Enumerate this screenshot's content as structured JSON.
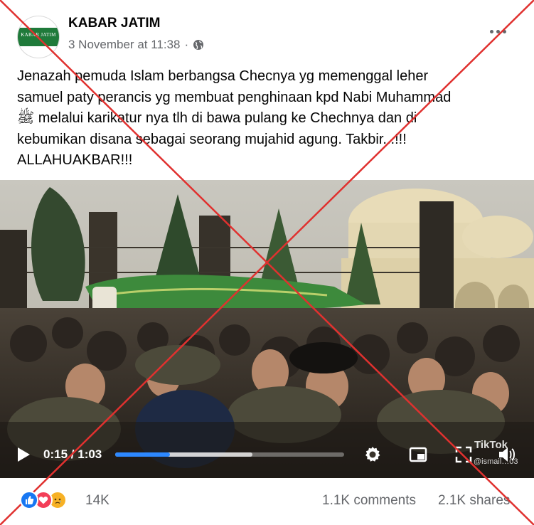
{
  "header": {
    "page_name": "KABAR JATIM",
    "timestamp": "3 November at 11:38",
    "separator": "·",
    "avatar_text": "KABAR JATIM",
    "icons": {
      "audience": "globe-icon",
      "more": "more-options-icon"
    }
  },
  "caption": "Jenazah pemuda Islam berbangsa Checnya yg memenggal leher\nsamuel paty perancis yg membuat penghinaan kpd Nabi Muhammad\nﷺ melalui karikatur nya tlh di bawa pulang ke Chechnya dan di\nkebumikan disana sebagai seorang mujahid agung. Takbir...!!!\nALLAHUAKBAR!!!",
  "video": {
    "current_time": "0:15",
    "separator": "/",
    "duration": "1:03",
    "played_fraction": 0.24,
    "buffered_fraction": 0.6,
    "watermark": "TikTok",
    "watermark_user": "@ismail…03",
    "icons": [
      "play-icon",
      "settings-icon",
      "picture-in-picture-icon",
      "fullscreen-icon",
      "volume-icon"
    ]
  },
  "footer": {
    "reactions": [
      "like",
      "love",
      "sad"
    ],
    "reaction_count": "14K",
    "comments": "1.1K comments",
    "shares": "2.1K shares"
  },
  "colors": {
    "accent": "#2d88ff",
    "secondary_text": "#65676b",
    "cross": "#e0312f",
    "like": "#1877f2",
    "love": "#f33e58",
    "sad": "#f7b125"
  }
}
